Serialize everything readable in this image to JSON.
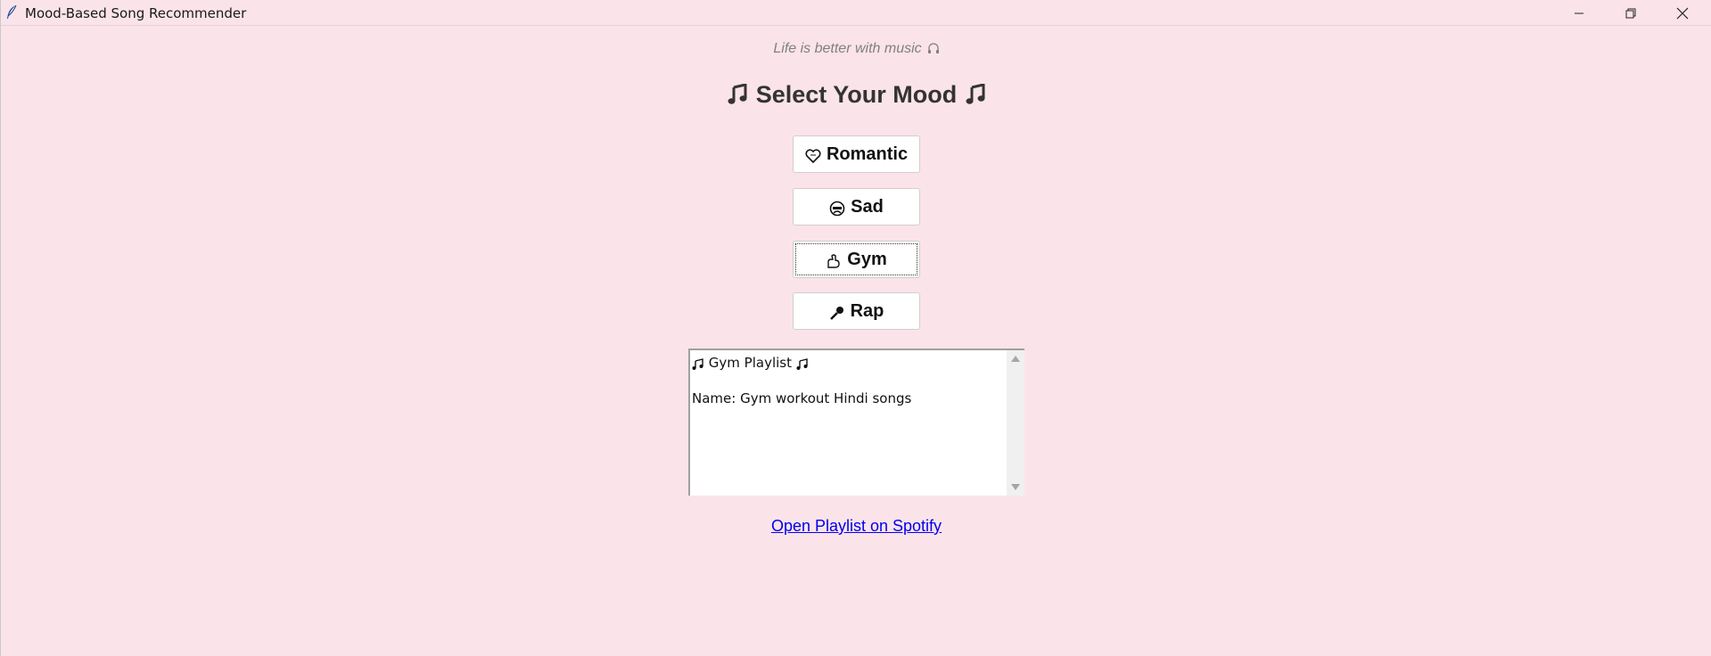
{
  "window": {
    "title": "Mood-Based Song Recommender",
    "app_icon": "feather-icon",
    "controls": [
      "minimize-icon",
      "restore-icon",
      "close-icon"
    ]
  },
  "tagline": {
    "text": "Life is better with music",
    "icon": "headphones-icon"
  },
  "heading": {
    "text": "Select Your Mood",
    "icon": "music-note-icon"
  },
  "moods": [
    {
      "label": "Romantic",
      "icon": "heart-icon"
    },
    {
      "label": "Sad",
      "icon": "crying-face-icon"
    },
    {
      "label": "Gym",
      "icon": "flexed-arm-icon"
    },
    {
      "label": "Rap",
      "icon": "microphone-icon"
    }
  ],
  "focused_mood": "Gym",
  "playlist_box": {
    "title": "Gym Playlist",
    "title_icon": "music-notes-icon",
    "name_line": "Name: Gym workout Hindi songs"
  },
  "link": {
    "text": "Open Playlist on Spotify"
  },
  "colors": {
    "background": "#fbe3ea",
    "link": "#0000ee",
    "heading": "#333333",
    "tagline": "#808080"
  }
}
